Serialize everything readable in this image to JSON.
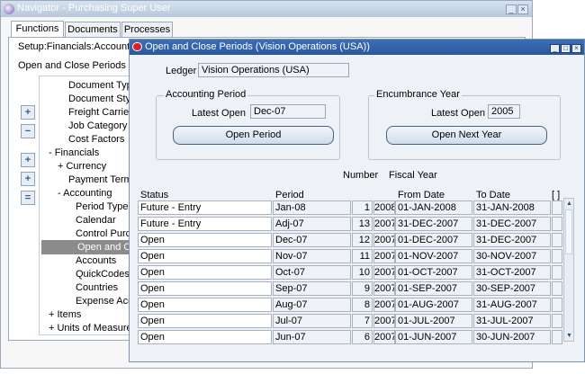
{
  "navigator": {
    "title": "Navigator - Purchasing Super User",
    "tabs": [
      {
        "label": "Functions",
        "active": true
      },
      {
        "label": "Documents",
        "active": false
      },
      {
        "label": "Processes",
        "active": false
      }
    ],
    "setup_path": "Setup:Financials:Accounting",
    "heading": "Open and Close Periods",
    "tree_items": [
      {
        "label": "Document Types",
        "indent": 2
      },
      {
        "label": "Document Styles",
        "indent": 2
      },
      {
        "label": "Freight Carriers",
        "indent": 2
      },
      {
        "label": "Job Category Assignment",
        "indent": 2
      },
      {
        "label": "Cost Factors",
        "indent": 2
      },
      {
        "label": "- Financials",
        "indent": 0
      },
      {
        "label": "+ Currency",
        "indent": 1
      },
      {
        "label": "Payment Terms",
        "indent": 2
      },
      {
        "label": "- Accounting",
        "indent": 1
      },
      {
        "label": "Period Types",
        "indent": 3
      },
      {
        "label": "Calendar",
        "indent": 3
      },
      {
        "label": "Control Purchasing Periods",
        "indent": 3
      },
      {
        "label": "Open and Close Periods",
        "indent": 3,
        "selected": true
      },
      {
        "label": "Accounts",
        "indent": 3
      },
      {
        "label": "QuickCodes",
        "indent": 3
      },
      {
        "label": "Countries",
        "indent": 3
      },
      {
        "label": "Expense Account Rules",
        "indent": 3
      },
      {
        "label": "+ Items",
        "indent": 0
      },
      {
        "label": "+ Units of Measure",
        "indent": 0
      }
    ]
  },
  "dialog": {
    "title": "Open and Close Periods (Vision Operations (USA))",
    "ledger_label": "Ledger",
    "ledger_value": "Vision Operations (USA)",
    "accounting_period": {
      "title": "Accounting Period",
      "latest_open_label": "Latest Open",
      "latest_open_value": "Dec-07",
      "button": "Open Period"
    },
    "encumbrance_year": {
      "title": "Encumbrance Year",
      "latest_open_label": "Latest Open",
      "latest_open_value": "2005",
      "button": "Open Next Year"
    },
    "table": {
      "headers": {
        "status": "Status",
        "period": "Period",
        "number": "Number",
        "fiscal_year": "Fiscal Year",
        "from_date": "From Date",
        "to_date": "To Date",
        "extra": "[ ]"
      },
      "rows": [
        {
          "status": "Future - Entry",
          "period": "Jan-08",
          "number": "1",
          "year": "2008",
          "from": "01-JAN-2008",
          "to": "31-JAN-2008"
        },
        {
          "status": "Future - Entry",
          "period": "Adj-07",
          "number": "13",
          "year": "2007",
          "from": "31-DEC-2007",
          "to": "31-DEC-2007"
        },
        {
          "status": "Open",
          "period": "Dec-07",
          "number": "12",
          "year": "2007",
          "from": "01-DEC-2007",
          "to": "31-DEC-2007"
        },
        {
          "status": "Open",
          "period": "Nov-07",
          "number": "11",
          "year": "2007",
          "from": "01-NOV-2007",
          "to": "30-NOV-2007"
        },
        {
          "status": "Open",
          "period": "Oct-07",
          "number": "10",
          "year": "2007",
          "from": "01-OCT-2007",
          "to": "31-OCT-2007"
        },
        {
          "status": "Open",
          "period": "Sep-07",
          "number": "9",
          "year": "2007",
          "from": "01-SEP-2007",
          "to": "30-SEP-2007"
        },
        {
          "status": "Open",
          "period": "Aug-07",
          "number": "8",
          "year": "2007",
          "from": "01-AUG-2007",
          "to": "31-AUG-2007"
        },
        {
          "status": "Open",
          "period": "Jul-07",
          "number": "7",
          "year": "2007",
          "from": "01-JUL-2007",
          "to": "31-JUL-2007"
        },
        {
          "status": "Open",
          "period": "Jun-07",
          "number": "6",
          "year": "2007",
          "from": "01-JUN-2007",
          "to": "30-JUN-2007"
        }
      ]
    }
  }
}
